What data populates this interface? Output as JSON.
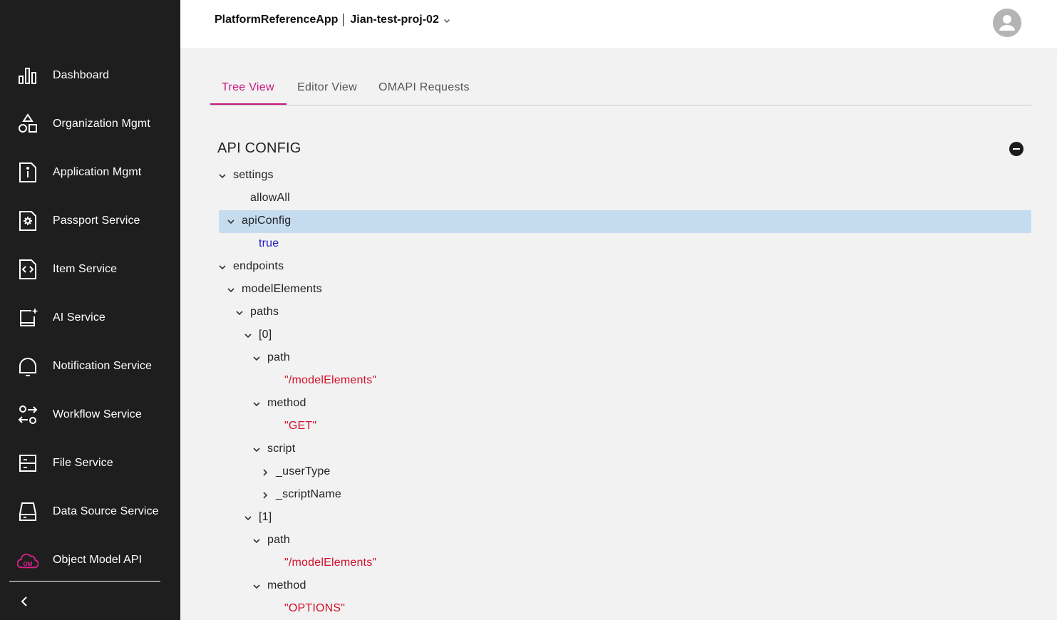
{
  "header": {
    "app_name": "PlatformReferenceApp",
    "project_name": "Jian-test-proj-02"
  },
  "sidebar": {
    "items": [
      {
        "label": "Dashboard",
        "icon": "bar-chart-icon"
      },
      {
        "label": "Organization Mgmt",
        "icon": "shapes-icon"
      },
      {
        "label": "Application Mgmt",
        "icon": "info-document-icon"
      },
      {
        "label": "Passport Service",
        "icon": "gear-document-icon"
      },
      {
        "label": "Item Service",
        "icon": "code-document-icon"
      },
      {
        "label": "AI Service",
        "icon": "sparkle-book-icon"
      },
      {
        "label": "Notification Service",
        "icon": "bell-icon"
      },
      {
        "label": "Workflow Service",
        "icon": "workflow-icon"
      },
      {
        "label": "File Service",
        "icon": "file-cabinet-icon"
      },
      {
        "label": "Data Source Service",
        "icon": "hard-drive-icon"
      },
      {
        "label": "Object Model API",
        "icon": "om-cloud-icon",
        "icon_text": "OM"
      }
    ]
  },
  "tabs": [
    {
      "label": "Tree View",
      "active": true
    },
    {
      "label": "Editor View",
      "active": false
    },
    {
      "label": "OMAPI Requests",
      "active": false
    }
  ],
  "tree": {
    "title": "API CONFIG",
    "rows": [
      {
        "text": "settings",
        "kind": "key",
        "caret": "down"
      },
      {
        "text": "allowAll",
        "kind": "key",
        "caret": "none"
      },
      {
        "text": "apiConfig",
        "kind": "key",
        "caret": "down",
        "selected": true
      },
      {
        "text": "true",
        "kind": "bool",
        "caret": "none"
      },
      {
        "text": "endpoints",
        "kind": "key",
        "caret": "down"
      },
      {
        "text": "modelElements",
        "kind": "key",
        "caret": "down"
      },
      {
        "text": "paths",
        "kind": "key",
        "caret": "down"
      },
      {
        "text": "[0]",
        "kind": "key",
        "caret": "down"
      },
      {
        "text": "path",
        "kind": "key",
        "caret": "down"
      },
      {
        "text": "\"/modelElements\"",
        "kind": "string",
        "caret": "none"
      },
      {
        "text": "method",
        "kind": "key",
        "caret": "down"
      },
      {
        "text": "\"GET\"",
        "kind": "string",
        "caret": "none"
      },
      {
        "text": "script",
        "kind": "key",
        "caret": "down"
      },
      {
        "text": "_userType",
        "kind": "key",
        "caret": "right"
      },
      {
        "text": "_scriptName",
        "kind": "key",
        "caret": "right"
      },
      {
        "text": "[1]",
        "kind": "key",
        "caret": "down"
      },
      {
        "text": "path",
        "kind": "key",
        "caret": "down"
      },
      {
        "text": "\"/modelElements\"",
        "kind": "string",
        "caret": "none"
      },
      {
        "text": "method",
        "kind": "key",
        "caret": "down"
      },
      {
        "text": "\"OPTIONS\"",
        "kind": "string",
        "caret": "none"
      }
    ]
  },
  "colors": {
    "sidebar_bg": "#1e1e1e",
    "accent": "#c8177f",
    "selection": "#c5dcef",
    "bool_value": "#1a1acb",
    "string_value": "#d2102a"
  }
}
